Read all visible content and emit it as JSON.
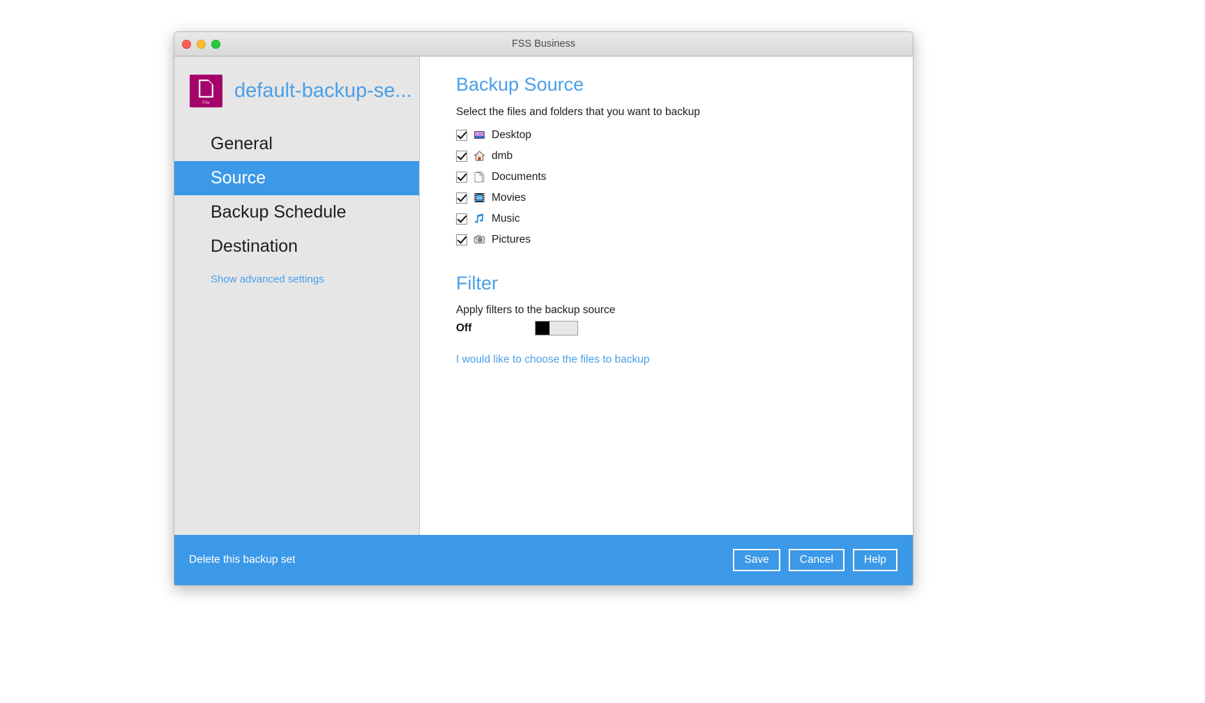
{
  "window": {
    "title": "FSS Business",
    "controls": [
      {
        "name": "close",
        "color": "#ff5f57"
      },
      {
        "name": "minimize",
        "color": "#ffbd2e"
      },
      {
        "name": "maximize",
        "color": "#28c940"
      }
    ]
  },
  "sidebar": {
    "set_name": "default-backup-se...",
    "set_icon_label": "File",
    "set_icon_color": "#a5026a",
    "items": [
      {
        "label": "General",
        "selected": false
      },
      {
        "label": "Source",
        "selected": true
      },
      {
        "label": "Backup Schedule",
        "selected": false
      },
      {
        "label": "Destination",
        "selected": false
      }
    ],
    "advanced_link": "Show advanced settings"
  },
  "content": {
    "source": {
      "heading": "Backup Source",
      "description": "Select the files and folders that you want to backup",
      "items": [
        {
          "label": "Desktop",
          "icon": "desktop-icon",
          "checked": true
        },
        {
          "label": "dmb",
          "icon": "home-icon",
          "checked": true
        },
        {
          "label": "Documents",
          "icon": "documents-icon",
          "checked": true
        },
        {
          "label": "Movies",
          "icon": "movies-icon",
          "checked": true
        },
        {
          "label": "Music",
          "icon": "music-icon",
          "checked": true
        },
        {
          "label": "Pictures",
          "icon": "pictures-icon",
          "checked": true
        }
      ]
    },
    "filter": {
      "heading": "Filter",
      "description": "Apply filters to the backup source",
      "state_label": "Off",
      "toggle_on": false
    },
    "choose_files_link": "I would like to choose the files to backup"
  },
  "bottom_bar": {
    "background": "#3b99e8",
    "delete_link": "Delete this backup set",
    "buttons": [
      {
        "label": "Save"
      },
      {
        "label": "Cancel"
      },
      {
        "label": "Help"
      }
    ]
  },
  "colors": {
    "accent_blue": "#3b99e8",
    "link_blue": "#4a9fe8",
    "sidebar_gray": "#e6e6e6"
  }
}
